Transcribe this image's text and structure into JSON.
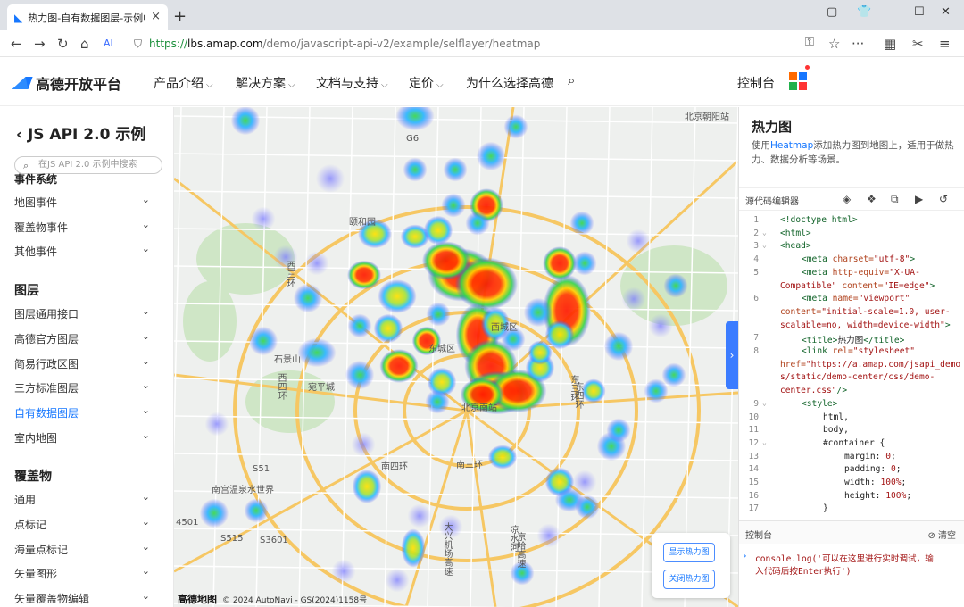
{
  "browser": {
    "tab_title": "热力图-自有数据图层-示例中",
    "url_scheme": "https://",
    "url_host": "lbs.amap.com",
    "url_path": "/demo/javascript-api-v2/example/selflayer/heatmap"
  },
  "header": {
    "logo_text": "高德开放平台",
    "menu": [
      "产品介绍",
      "解决方案",
      "文档与支持",
      "定价",
      "为什么选择高德"
    ],
    "console_link": "控制台"
  },
  "sidebar": {
    "title": "JS API 2.0 示例",
    "search_placeholder": "在JS API 2.0 示例中搜索",
    "cut_heading": "事件系统",
    "groups": [
      {
        "heading": "",
        "items": [
          "地图事件",
          "覆盖物事件",
          "其他事件"
        ]
      },
      {
        "heading": "图层",
        "items": [
          "图层通用接口",
          "高德官方图层",
          "简易行政区图",
          "三方标准图层",
          "自有数据图层",
          "室内地图"
        ]
      },
      {
        "heading": "覆盖物",
        "items": [
          "通用",
          "点标记",
          "海量点标记",
          "矢量图形",
          "矢量覆盖物编辑"
        ]
      }
    ],
    "active_item": "自有数据图层"
  },
  "map": {
    "labels": [
      "西三环",
      "西四环",
      "颐和园",
      "西城区",
      "东城区",
      "东三环",
      "东四环",
      "石景山",
      "南四环",
      "南三环",
      "南宫温泉水世界",
      "凉水河",
      "大兴机场高速",
      "京哈高速",
      "北京南站",
      "宛平城",
      "S515",
      "S3601",
      "4501",
      "S51",
      "G6",
      "北京朝阳站"
    ],
    "copyright": "© 2024 AutoNavi - GS(2024)1158号",
    "brand": "高德地图",
    "btn_show": "显示热力图",
    "btn_hide": "关闭热力图"
  },
  "panel": {
    "title": "热力图",
    "desc_prefix": "使用",
    "desc_link": "Heatmap",
    "desc_suffix": "添加热力图到地图上，适用于做热力、数据分析等场景。",
    "editor_label": "源代码编辑器",
    "console_label": "控制台",
    "clear_label": "清空",
    "console_line1": "console.log('可以在这里进行实时调试，输",
    "console_line2": "入代码后按Enter执行')"
  },
  "code_lines": [
    {
      "n": "1",
      "fold": "",
      "indent": 0,
      "segs": [
        [
          "tag",
          "<!doctype html>"
        ]
      ]
    },
    {
      "n": "2",
      "fold": "⌄",
      "indent": 0,
      "segs": [
        [
          "tag",
          "<html>"
        ]
      ]
    },
    {
      "n": "3",
      "fold": "⌄",
      "indent": 0,
      "segs": [
        [
          "tag",
          "<head>"
        ]
      ]
    },
    {
      "n": "4",
      "fold": "",
      "indent": 1,
      "segs": [
        [
          "tag",
          "<meta "
        ],
        [
          "att",
          "charset="
        ],
        [
          "str",
          "\"utf-8\""
        ],
        [
          "tag",
          ">"
        ]
      ]
    },
    {
      "n": "5",
      "fold": "",
      "indent": 1,
      "segs": [
        [
          "tag",
          "<meta "
        ],
        [
          "att",
          "http-equiv="
        ],
        [
          "str",
          "\"X-UA-"
        ]
      ]
    },
    {
      "n": "",
      "fold": "",
      "indent": 0,
      "segs": [
        [
          "str",
          "Compatible\""
        ],
        [
          "att",
          " content="
        ],
        [
          "str",
          "\"IE=edge\""
        ],
        [
          "tag",
          ">"
        ]
      ]
    },
    {
      "n": "6",
      "fold": "",
      "indent": 1,
      "segs": [
        [
          "tag",
          "<meta "
        ],
        [
          "att",
          "name="
        ],
        [
          "str",
          "\"viewport\""
        ]
      ]
    },
    {
      "n": "",
      "fold": "",
      "indent": 0,
      "segs": [
        [
          "att",
          "content="
        ],
        [
          "str",
          "\"initial-scale=1.0, user-"
        ]
      ]
    },
    {
      "n": "",
      "fold": "",
      "indent": 0,
      "segs": [
        [
          "str",
          "scalable=no, width=device-width\""
        ],
        [
          "tag",
          ">"
        ]
      ]
    },
    {
      "n": "7",
      "fold": "",
      "indent": 1,
      "segs": [
        [
          "tag",
          "<title>"
        ],
        [
          "plain",
          "热力图"
        ],
        [
          "tag",
          "</title>"
        ]
      ]
    },
    {
      "n": "8",
      "fold": "",
      "indent": 1,
      "segs": [
        [
          "tag",
          "<link "
        ],
        [
          "att",
          "rel="
        ],
        [
          "str",
          "\"stylesheet\""
        ]
      ]
    },
    {
      "n": "",
      "fold": "",
      "indent": 0,
      "segs": [
        [
          "att",
          "href="
        ],
        [
          "str",
          "\"https://a.amap.com/jsapi_demo"
        ]
      ]
    },
    {
      "n": "",
      "fold": "",
      "indent": 0,
      "segs": [
        [
          "str",
          "s/static/demo-center/css/demo-"
        ]
      ]
    },
    {
      "n": "",
      "fold": "",
      "indent": 0,
      "segs": [
        [
          "str",
          "center.css\""
        ],
        [
          "tag",
          "/>"
        ]
      ]
    },
    {
      "n": "9",
      "fold": "⌄",
      "indent": 1,
      "segs": [
        [
          "tag",
          "<style>"
        ]
      ]
    },
    {
      "n": "10",
      "fold": "",
      "indent": 2,
      "segs": [
        [
          "plain",
          "html,"
        ]
      ]
    },
    {
      "n": "11",
      "fold": "",
      "indent": 2,
      "segs": [
        [
          "plain",
          "body,"
        ]
      ]
    },
    {
      "n": "12",
      "fold": "⌄",
      "indent": 2,
      "segs": [
        [
          "plain",
          "#container {"
        ]
      ]
    },
    {
      "n": "13",
      "fold": "",
      "indent": 3,
      "segs": [
        [
          "plain",
          "margin: "
        ],
        [
          "str",
          "0"
        ],
        [
          "plain",
          ";"
        ]
      ]
    },
    {
      "n": "14",
      "fold": "",
      "indent": 3,
      "segs": [
        [
          "plain",
          "padding: "
        ],
        [
          "str",
          "0"
        ],
        [
          "plain",
          ";"
        ]
      ]
    },
    {
      "n": "15",
      "fold": "",
      "indent": 3,
      "segs": [
        [
          "plain",
          "width: "
        ],
        [
          "str",
          "100%"
        ],
        [
          "plain",
          ";"
        ]
      ]
    },
    {
      "n": "16",
      "fold": "",
      "indent": 3,
      "segs": [
        [
          "plain",
          "height: "
        ],
        [
          "str",
          "100%"
        ],
        [
          "plain",
          ";"
        ]
      ]
    },
    {
      "n": "17",
      "fold": "",
      "indent": 2,
      "segs": [
        [
          "plain",
          "}"
        ]
      ]
    }
  ],
  "colors": {
    "accent": "#1677ff",
    "heat_hot": "#ff2a00",
    "heat_warm": "#ffd400",
    "heat_cool": "#2ad14a",
    "heat_cold": "#3b3bff"
  }
}
